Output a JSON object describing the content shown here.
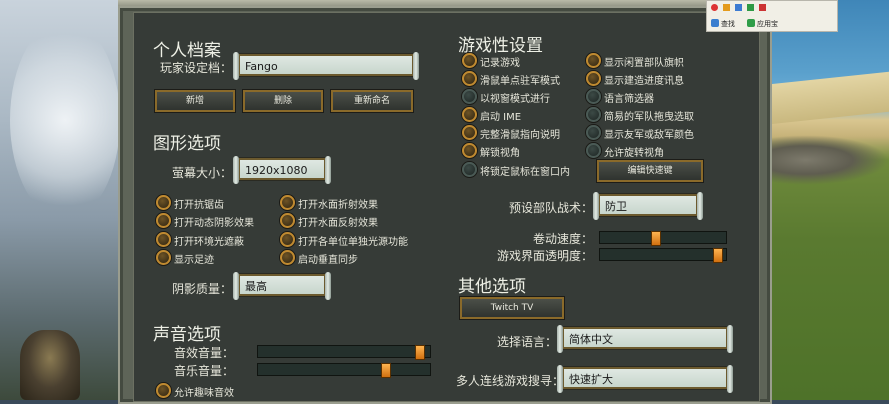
{
  "personal": {
    "title": "个人档案",
    "profile_label": "玩家设定档：",
    "profile_value": "Fango",
    "new_btn": "新增",
    "delete_btn": "删除",
    "rename_btn": "重新命名"
  },
  "graphics": {
    "title": "图形选项",
    "resolution_label": "萤幕大小：",
    "resolution_value": "1920x1080",
    "options": [
      {
        "label": "打开抗锯齿",
        "checked": true
      },
      {
        "label": "打开水面折射效果",
        "checked": true
      },
      {
        "label": "打开动态阴影效果",
        "checked": true
      },
      {
        "label": "打开水面反射效果",
        "checked": true
      },
      {
        "label": "打开环境光遮蔽",
        "checked": true
      },
      {
        "label": "打开各单位单独光源功能",
        "checked": true
      },
      {
        "label": "显示足迹",
        "checked": true
      },
      {
        "label": "启动垂直同步",
        "checked": true
      }
    ],
    "shadow_label": "阴影质量：",
    "shadow_value": "最高"
  },
  "sound": {
    "title": "声音选项",
    "sfx_label": "音效音量：",
    "sfx_level": 0.97,
    "music_label": "音乐音量：",
    "music_level": 0.76,
    "fun_sound_label": "允许趣味音效",
    "fun_sound_checked": true
  },
  "gameplay": {
    "title": "游戏性设置",
    "options": [
      {
        "label": "记录游戏",
        "checked": true
      },
      {
        "label": "显示闲置部队旗帜",
        "checked": true
      },
      {
        "label": "滑鼠单点驻军模式",
        "checked": true
      },
      {
        "label": "显示建造进度讯息",
        "checked": true
      },
      {
        "label": "以视窗模式进行",
        "checked": false
      },
      {
        "label": "语言筛选器",
        "checked": false
      },
      {
        "label": "启动 IME",
        "checked": true
      },
      {
        "label": "简易的军队拖曳选取",
        "checked": false
      },
      {
        "label": "完整滑鼠指向说明",
        "checked": true
      },
      {
        "label": "显示友军或敌军颜色",
        "checked": false
      },
      {
        "label": "解锁视角",
        "checked": true
      },
      {
        "label": "允许旋转视角",
        "checked": false
      },
      {
        "label": "将锁定鼠标在窗口内",
        "checked": false
      }
    ],
    "edit_hotkeys_btn": "编辑快速键",
    "default_tactic_label": "预设部队战术：",
    "default_tactic_value": "防卫",
    "scroll_speed_label": "卷动速度：",
    "scroll_speed_level": 0.44,
    "ui_opacity_label": "游戏界面透明度：",
    "ui_opacity_level": 0.97
  },
  "other": {
    "title": "其他选项",
    "twitch_btn": "Twitch TV",
    "language_label": "选择语言：",
    "language_value": "简体中文",
    "mp_search_label": "多人连线游戏搜寻：",
    "mp_search_value": "快速扩大"
  },
  "browser_toolbar": {
    "search_label": "查找",
    "apps_label": "应用宝"
  }
}
